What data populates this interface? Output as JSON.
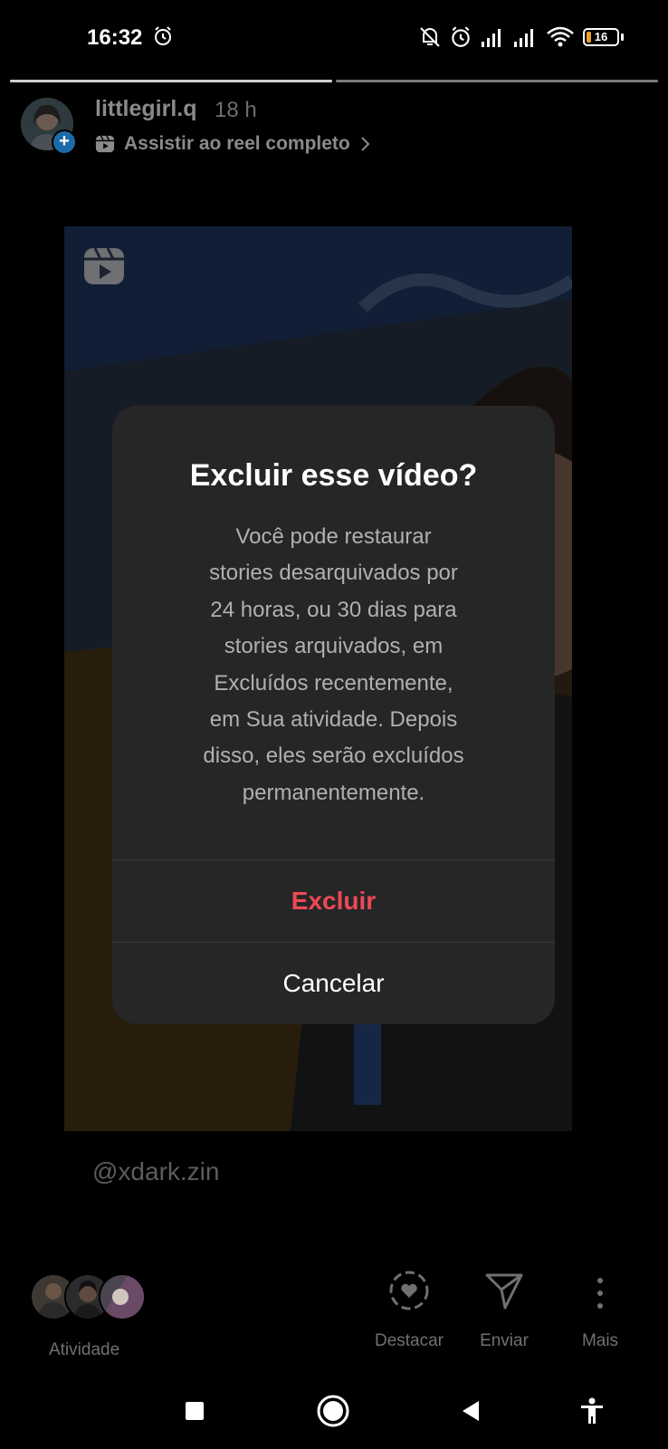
{
  "status_bar": {
    "time": "16:32",
    "battery_percent": "16",
    "battery_level": 0.16,
    "icons": [
      "alarm-icon",
      "mute-bell-icon",
      "alarm-icon",
      "signal-icon",
      "signal-icon",
      "wifi-icon",
      "battery-icon"
    ]
  },
  "story": {
    "progress": [
      1.0,
      0.0
    ],
    "username": "littlegirl.q",
    "time_ago": "18 h",
    "reel_link": "Assistir ao reel completo",
    "mention": "@xdark.zin"
  },
  "dialog": {
    "title": "Excluir esse vídeo?",
    "body": "Você pode restaurar\nstories desarquivados por\n24 horas, ou 30 dias para\nstories arquivados, em\nExcluídos recentemente,\nem Sua atividade. Depois\ndisso, eles serão excluídos\npermanentemente.",
    "delete_label": "Excluir",
    "cancel_label": "Cancelar",
    "delete_color": "#ed4956"
  },
  "bottom_bar": {
    "activity_label": "Atividade",
    "highlight_label": "Destacar",
    "send_label": "Enviar",
    "more_label": "Mais"
  },
  "nav_bar": {
    "icons": [
      "recents-square-icon",
      "home-circle-icon",
      "back-triangle-icon",
      "accessibility-icon"
    ]
  }
}
